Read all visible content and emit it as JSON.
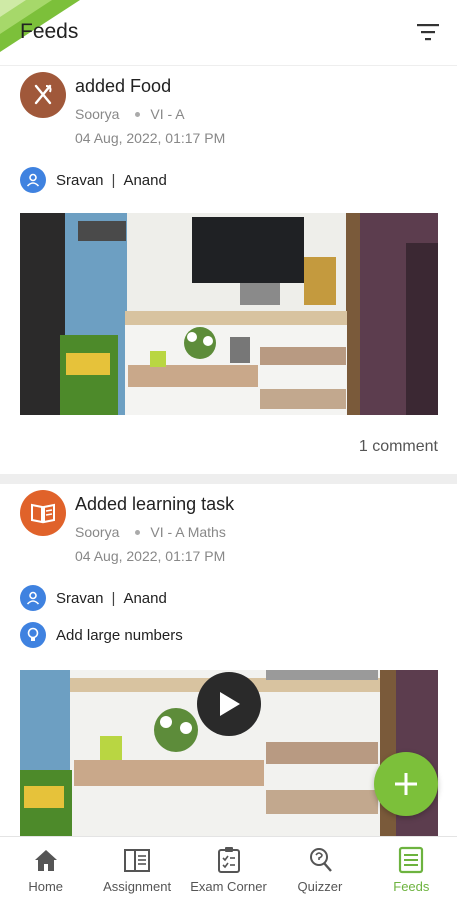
{
  "header": {
    "title": "Feeds",
    "filter_icon": "filter-icon"
  },
  "colors": {
    "accent": "#7cc03a",
    "food_avatar": "#a0583a",
    "task_avatar": "#e0622a",
    "tag_icon": "#3f82e0"
  },
  "feeds": [
    {
      "title": "added Food",
      "author": "Soorya",
      "class": "VI - A",
      "date": "04 Aug, 2022, 01:17 PM",
      "people": [
        "Sravan",
        "Anand"
      ],
      "comments": "1 comment",
      "avatar_icon": "fork-knife-icon"
    },
    {
      "title": "Added learning task",
      "author": "Soorya",
      "class": "VI - A Maths",
      "date": "04 Aug, 2022, 01:17 PM",
      "people": [
        "Sravan",
        "Anand"
      ],
      "topic": "Add large numbers",
      "avatar_icon": "book-icon"
    }
  ],
  "fab_icon": "plus-icon",
  "nav": [
    {
      "label": "Home",
      "icon": "home-icon"
    },
    {
      "label": "Assignment",
      "icon": "assignment-icon"
    },
    {
      "label": "Exam Corner",
      "icon": "exam-corner-icon"
    },
    {
      "label": "Quizzer",
      "icon": "quizzer-icon"
    },
    {
      "label": "Feeds",
      "icon": "feeds-icon",
      "active": true
    }
  ]
}
